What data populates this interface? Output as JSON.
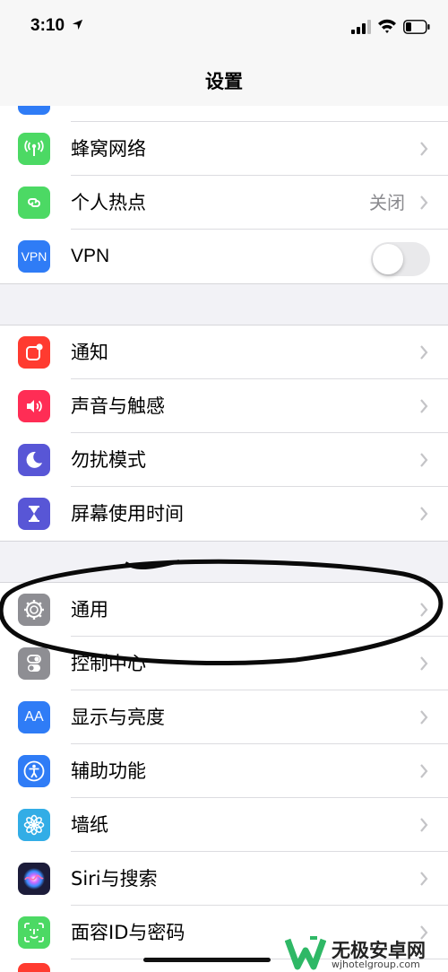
{
  "status": {
    "time": "3:10",
    "location_icon": "location-arrow-icon",
    "signal_icon": "cellular-signal-icon",
    "wifi_icon": "wifi-icon",
    "battery_icon": "battery-icon"
  },
  "nav": {
    "title": "设置"
  },
  "group1": [
    {
      "label": "蜂窝网络",
      "icon": "cellular-antenna-icon",
      "color": "#4cd964"
    },
    {
      "label": "个人热点",
      "icon": "hotspot-link-icon",
      "color": "#4cd964",
      "value": "关闭"
    },
    {
      "label": "VPN",
      "icon": "vpn-icon",
      "icon_text": "VPN",
      "color": "#2f7cf6",
      "toggle_on": false
    }
  ],
  "group2": [
    {
      "label": "通知",
      "icon": "notifications-icon",
      "color": "#ff3b30"
    },
    {
      "label": "声音与触感",
      "icon": "speaker-icon",
      "color": "#ff2d55"
    },
    {
      "label": "勿扰模式",
      "icon": "moon-icon",
      "color": "#5856d6"
    },
    {
      "label": "屏幕使用时间",
      "icon": "hourglass-icon",
      "color": "#5856d6"
    }
  ],
  "group3": [
    {
      "label": "通用",
      "icon": "gear-icon",
      "color": "#8e8e93"
    },
    {
      "label": "控制中心",
      "icon": "toggles-icon",
      "color": "#8e8e93"
    },
    {
      "label": "显示与亮度",
      "icon": "display-brightness-icon",
      "icon_text": "AA",
      "color": "#2f7cf6"
    },
    {
      "label": "辅助功能",
      "icon": "accessibility-icon",
      "color": "#2f7cf6"
    },
    {
      "label": "墙纸",
      "icon": "wallpaper-flower-icon",
      "color": "#32ade6"
    },
    {
      "label": "Siri与搜索",
      "icon": "siri-icon",
      "color": "#1c1c3a"
    },
    {
      "label": "面容ID与密码",
      "icon": "face-id-icon",
      "color": "#4cd964"
    }
  ],
  "watermark": {
    "text": "无极安卓网",
    "sub": "wjhotelgroup.com"
  },
  "colors": {
    "annotation_ink": "#0a0a0a",
    "chevron": "#c4c4c7"
  }
}
